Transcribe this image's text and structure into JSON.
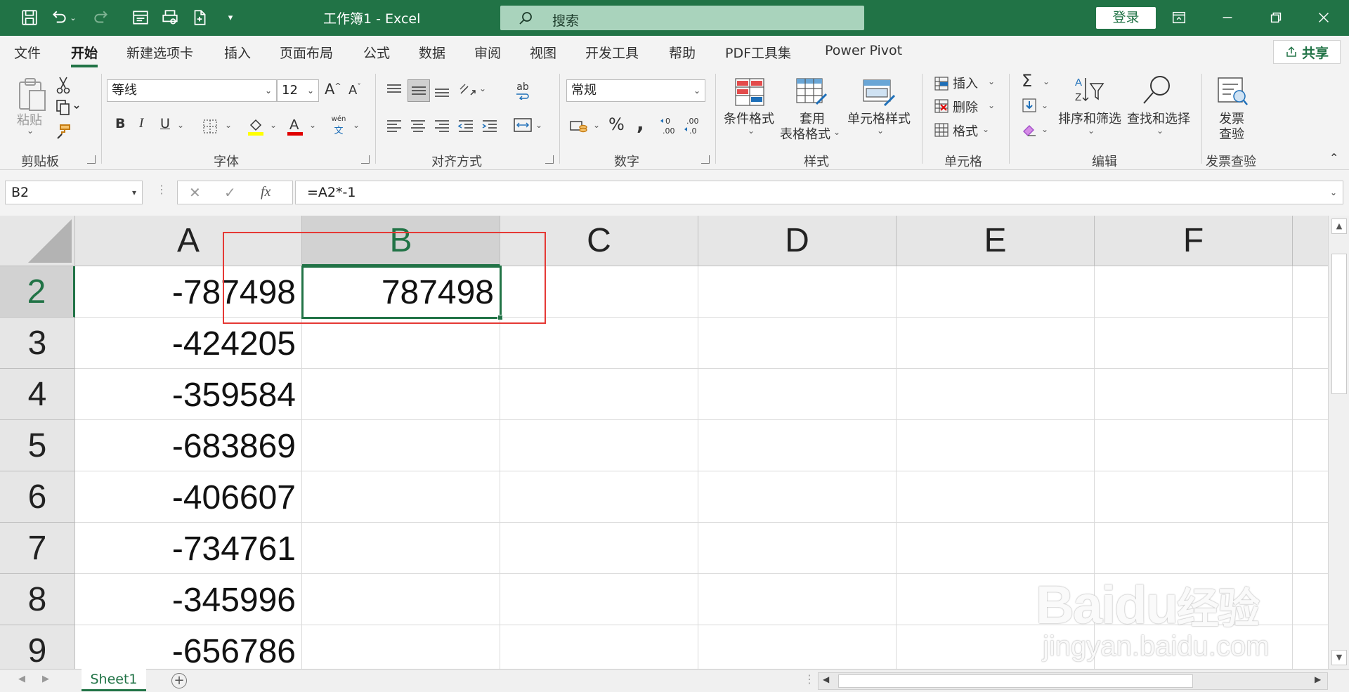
{
  "titlebar": {
    "doc_title": "工作簿1  -  Excel",
    "search_placeholder": "搜索",
    "login": "登录"
  },
  "menu": {
    "tabs": [
      "文件",
      "开始",
      "新建选项卡",
      "插入",
      "页面布局",
      "公式",
      "数据",
      "审阅",
      "视图",
      "开发工具",
      "帮助",
      "PDF工具集",
      "Power Pivot"
    ],
    "active": "开始",
    "share": "共享"
  },
  "ribbon": {
    "clipboard": {
      "label": "剪贴板",
      "paste": "粘贴"
    },
    "font": {
      "label": "字体",
      "name": "等线",
      "size": "12",
      "phonetic_top": "wén",
      "phonetic_bottom": "文"
    },
    "alignment": {
      "label": "对齐方式",
      "wrap": "ab"
    },
    "number": {
      "label": "数字",
      "format": "常规"
    },
    "styles": {
      "label": "样式",
      "conditional": "条件格式",
      "table_line1": "套用",
      "table_line2": "表格格式",
      "cell_styles": "单元格样式"
    },
    "cells": {
      "label": "单元格",
      "insert": "插入",
      "delete": "删除",
      "format": "格式"
    },
    "editing": {
      "label": "编辑",
      "sort": "排序和筛选",
      "find": "查找和选择"
    },
    "invoice": {
      "label": "发票查验",
      "line1": "发票",
      "line2": "查验"
    }
  },
  "formula_bar": {
    "name_box": "B2",
    "fx": "fx",
    "formula": "=A2*-1"
  },
  "grid": {
    "columns": [
      "A",
      "B",
      "C",
      "D",
      "E",
      "F"
    ],
    "selected_column": "B",
    "selected_row": "2",
    "rows": [
      {
        "num": "2",
        "a": "-787498",
        "b": "787498"
      },
      {
        "num": "3",
        "a": "-424205",
        "b": ""
      },
      {
        "num": "4",
        "a": "-359584",
        "b": ""
      },
      {
        "num": "5",
        "a": "-683869",
        "b": ""
      },
      {
        "num": "6",
        "a": "-406607",
        "b": ""
      },
      {
        "num": "7",
        "a": "-734761",
        "b": ""
      },
      {
        "num": "8",
        "a": "-345996",
        "b": ""
      },
      {
        "num": "9",
        "a": "-656786",
        "b": ""
      }
    ]
  },
  "sheets": {
    "tabs": [
      "Sheet1"
    ],
    "active": "Sheet1"
  },
  "watermark": {
    "brand": "Baidu",
    "brand_cn": "经验",
    "url": "jingyan.baidu.com"
  },
  "colors": {
    "accent": "#217346",
    "annotation": "#e53935",
    "search_bg": "#a9d3bc"
  }
}
